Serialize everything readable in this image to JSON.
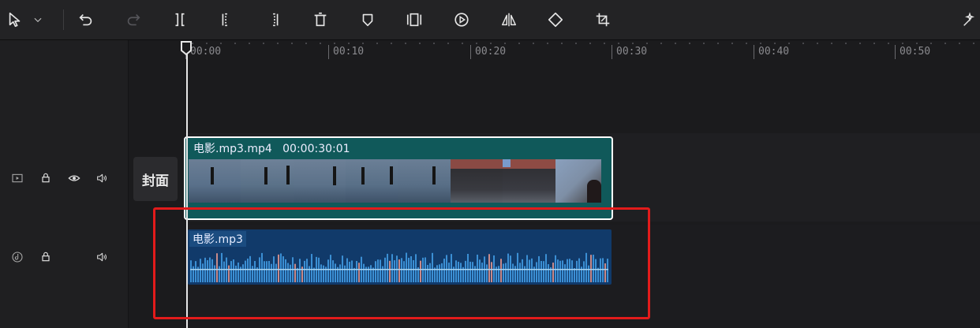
{
  "toolbar": {
    "icons": [
      "pointer-icon",
      "chevron-down-icon",
      "undo-icon",
      "redo-icon",
      "split-icon",
      "split-left-icon",
      "split-right-icon",
      "delete-icon",
      "marker-icon",
      "freeze-frame-icon",
      "reverse-play-icon",
      "mirror-icon",
      "rotate-icon",
      "crop-icon",
      "magic-icon"
    ]
  },
  "ruler": {
    "labels": [
      "00:00",
      "00:10",
      "00:20",
      "00:30",
      "00:40",
      "00:50"
    ]
  },
  "cover": {
    "label": "封面"
  },
  "video_track": {
    "clip_name": "电影.mp3.mp4",
    "clip_duration": "00:00:30:01"
  },
  "audio_track": {
    "clip_name": "电影.mp3"
  },
  "colors": {
    "video_clip": "#10595a",
    "audio_clip": "#113a6a",
    "highlight": "#e21b1b"
  }
}
